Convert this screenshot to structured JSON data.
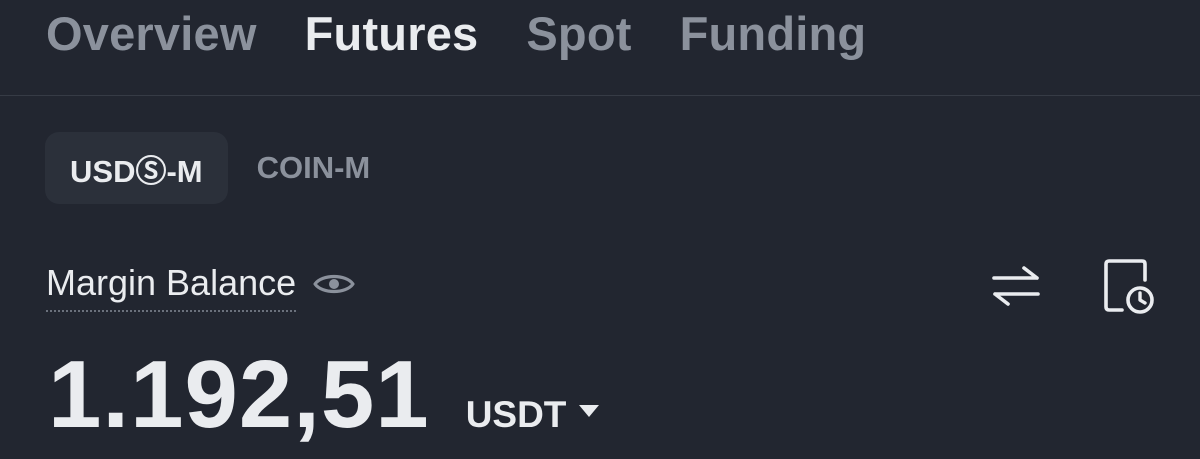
{
  "top_tabs": [
    {
      "label": "Overview",
      "active": false
    },
    {
      "label": "Futures",
      "active": true
    },
    {
      "label": "Spot",
      "active": false
    },
    {
      "label": "Funding",
      "active": false
    }
  ],
  "sub_tabs": [
    {
      "label": "USDⓈ-M",
      "active": true
    },
    {
      "label": "COIN-M",
      "active": false
    }
  ],
  "balance": {
    "label": "Margin Balance",
    "visibility_icon": "eye-icon",
    "amount": "1.192,51",
    "currency": "USDT",
    "currency_dropdown_icon": "caret-down-icon"
  },
  "actions": {
    "transfer_icon": "transfer-arrows-icon",
    "history_icon": "history-document-icon"
  },
  "colors": {
    "background": "#222630",
    "active_text": "#EAECEF",
    "inactive_text": "#8B919C",
    "active_chip": "#2B303A",
    "divider": "#363B45"
  }
}
